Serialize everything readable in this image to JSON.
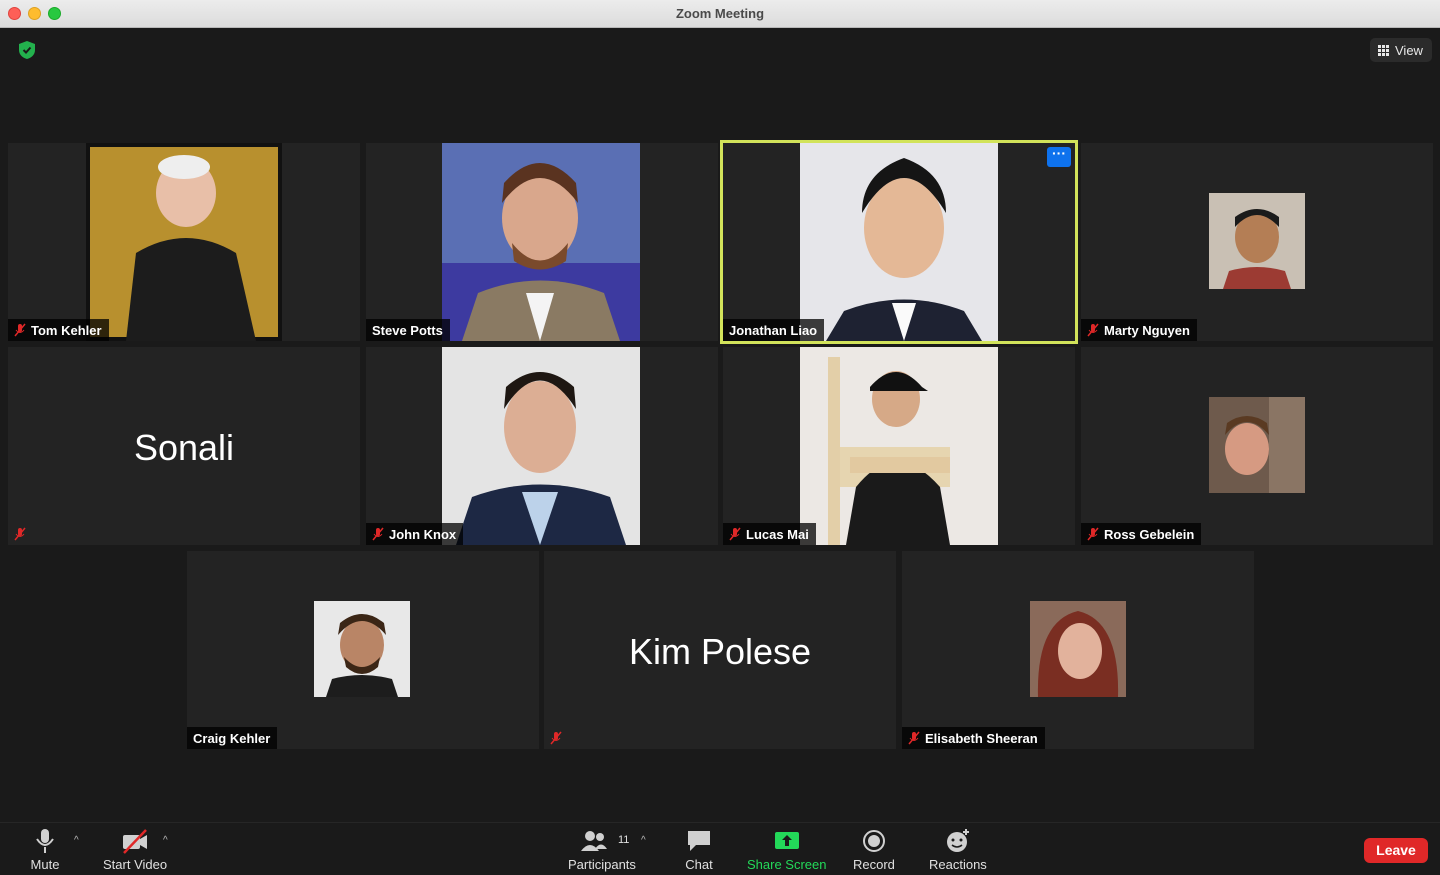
{
  "window": {
    "title": "Zoom Meeting"
  },
  "header": {
    "view_label": "View"
  },
  "participants": [
    {
      "name": "Tom Kehler",
      "muted": true
    },
    {
      "name": "Steve Potts",
      "muted": false
    },
    {
      "name": "Jonathan Liao",
      "muted": false,
      "active": true
    },
    {
      "name": "Marty Nguyen",
      "muted": true
    },
    {
      "name": "Sonali",
      "muted": true,
      "video": false
    },
    {
      "name": "John Knox",
      "muted": true
    },
    {
      "name": "Lucas Mai",
      "muted": true
    },
    {
      "name": "Ross Gebelein",
      "muted": true
    },
    {
      "name": "Craig Kehler",
      "muted": false
    },
    {
      "name": "Kim Polese",
      "muted": true,
      "video": false
    },
    {
      "name": "Elisabeth Sheeran",
      "muted": true
    }
  ],
  "toolbar": {
    "mute_label": "Mute",
    "start_video_label": "Start Video",
    "participants_label": "Participants",
    "participants_count": "11",
    "chat_label": "Chat",
    "share_screen_label": "Share Screen",
    "record_label": "Record",
    "reactions_label": "Reactions",
    "leave_label": "Leave"
  },
  "colors": {
    "active_speaker_border": "#d2e35a",
    "share_screen": "#23d959",
    "leave": "#e02828",
    "more_button": "#0e72ed"
  }
}
